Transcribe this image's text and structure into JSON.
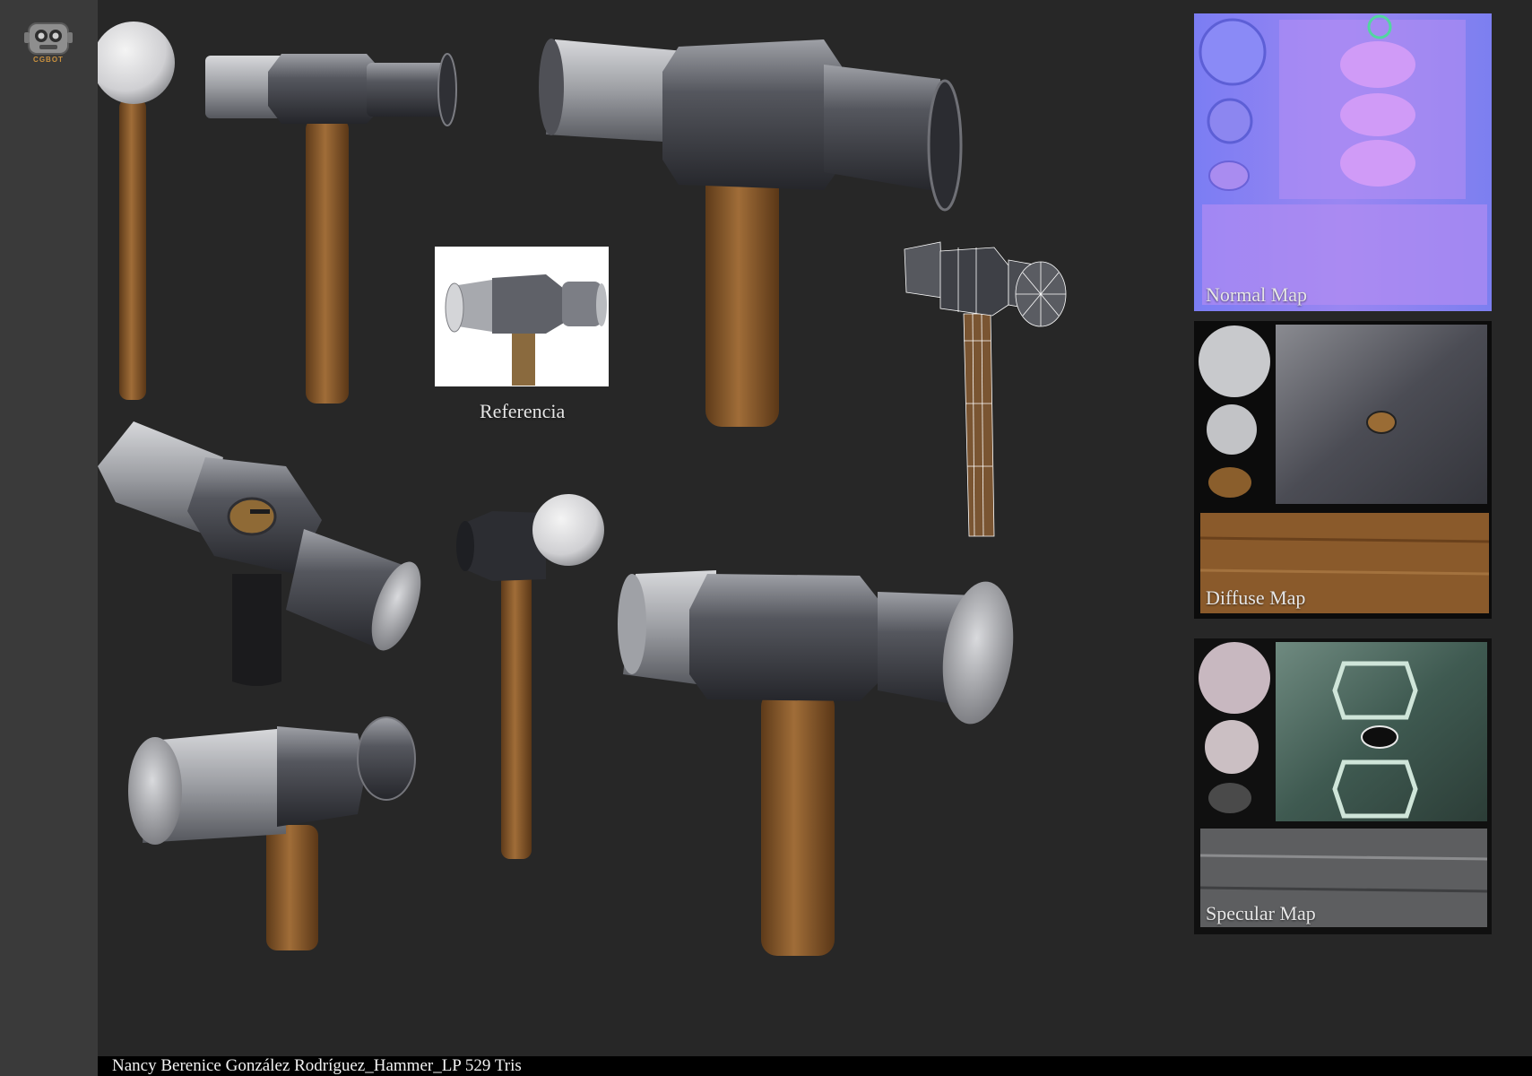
{
  "logo": {
    "text": "CGBOT",
    "icon": "robot-head-icon",
    "accent": "#c9913f"
  },
  "reference": {
    "caption": "Referencia"
  },
  "maps": {
    "normal": "Normal Map",
    "diffuse": "Diffuse Map",
    "specular": "Specular Map"
  },
  "footer": {
    "text": "Nancy Berenice González Rodríguez_Hammer_LP 529 Tris"
  },
  "colors": {
    "background": "#272727",
    "metal_dark": "#3c3e45",
    "metal_light": "#c9cacd",
    "wood": "#8a5a2b",
    "normal_map": "#7d7cf2"
  }
}
